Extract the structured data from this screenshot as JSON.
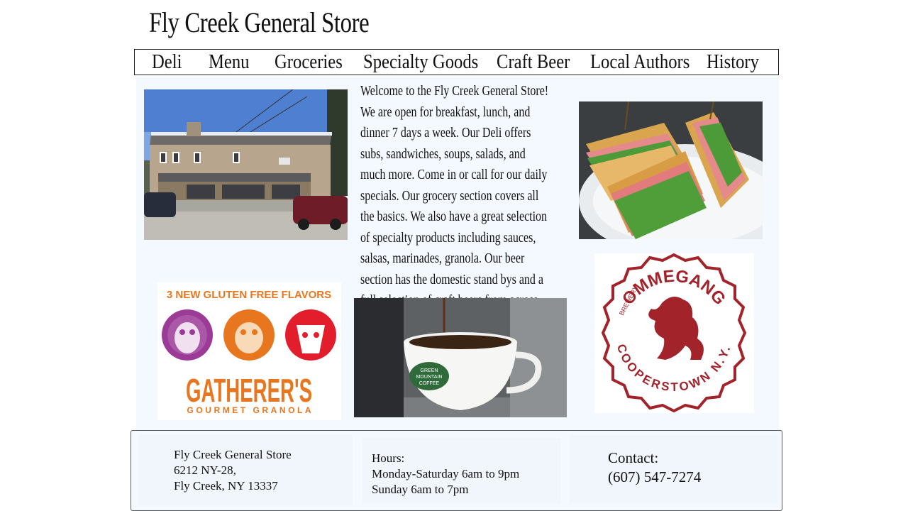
{
  "site": {
    "title": "Fly Creek General Store"
  },
  "nav": {
    "items": [
      "Deli",
      "Menu",
      "Groceries",
      "Specialty Goods",
      "Craft Beer",
      "Local Authors",
      "History"
    ]
  },
  "welcome": {
    "text": "Welcome to the Fly Creek General Store! We are open for breakfast, lunch, and dinner 7 days a week. Our Deli offers subs, sandwiches, soups, salads, and much more. Come in or call for our daily specials. Our grocery section  covers all the basics. We also have a great selection of specialty products including sauces, salsas, marinades, granola. Our beer section has the domestic stand bys and a full selection of craft beers from across the US. Come join us for a freshly brewed cup of Green Mountain coffee."
  },
  "images": {
    "granola": {
      "banner": "3 NEW GLUTEN FREE FLAVORS",
      "brand": "GATHERER'S",
      "sub": "GOURMET GRANOLA"
    },
    "coffee": {
      "cup_logo_line1": "GREEN",
      "cup_logo_line2": "MOUNTAIN",
      "cup_logo_line3": "COFFEE"
    },
    "ommegang": {
      "brewery": "BREWERY",
      "name": "OMMEGANG",
      "location": "COOPERSTOWN N.Y."
    }
  },
  "footer": {
    "address": {
      "line1": "Fly Creek General Store",
      "line2": "6212 NY-28,",
      "line3": "Fly Creek, NY 13337"
    },
    "hours": {
      "label": "Hours:",
      "weekdays": "Monday-Saturday 6am to 9pm",
      "sunday": "Sunday 6am to 7pm"
    },
    "contact": {
      "label": "Contact:",
      "phone": "(607) 547-7274"
    }
  },
  "colors": {
    "panel_bg": "#f3f9fe",
    "granola_orange": "#e8761e",
    "ommegang_red": "#a3232b"
  }
}
